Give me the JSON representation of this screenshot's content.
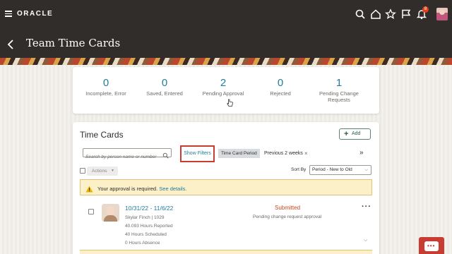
{
  "topbar": {
    "brand": "ORACLE",
    "notification_count": "8",
    "icons": [
      "menu-icon",
      "search-icon",
      "home-icon",
      "star-icon",
      "flag-icon",
      "bell-icon",
      "user-avatar"
    ]
  },
  "header": {
    "title": "Team Time Cards"
  },
  "summary": {
    "metrics": [
      {
        "value": "0",
        "label": "Incomplete, Error"
      },
      {
        "value": "0",
        "label": "Saved, Entered"
      },
      {
        "value": "2",
        "label": "Pending Approval"
      },
      {
        "value": "0",
        "label": "Rejected"
      },
      {
        "value": "1",
        "label": "Pending Change Requests"
      }
    ]
  },
  "timecards": {
    "title": "Time Cards",
    "add_label": "Add",
    "search_placeholder": "Search by person name or number",
    "show_filters": "Show Filters",
    "filter_chip": "Time Card Period",
    "filter_value": "Previous 2 weeks",
    "filter_remove": "×",
    "more": "»",
    "actions_label": "Actions",
    "sort_label": "Sort By",
    "sort_value": "Period - New to Old",
    "alert_text": "Your approval is required.",
    "alert_link": "See details.",
    "rows": [
      {
        "period": "10/31/22 - 11/6/22",
        "person": "Skylar Finch | 1029",
        "reported": "40.093 Hours Reported",
        "scheduled": "40 Hours Scheduled",
        "absence": "0 Hours Absence",
        "status": "Submitted",
        "substatus": "Pending change request approval"
      }
    ]
  },
  "colors": {
    "topbar": "#312d2a",
    "link": "#227c9d",
    "status": "#c7471a",
    "highlight_border": "#c73d33",
    "alert_bg": "#fbf0c8"
  }
}
